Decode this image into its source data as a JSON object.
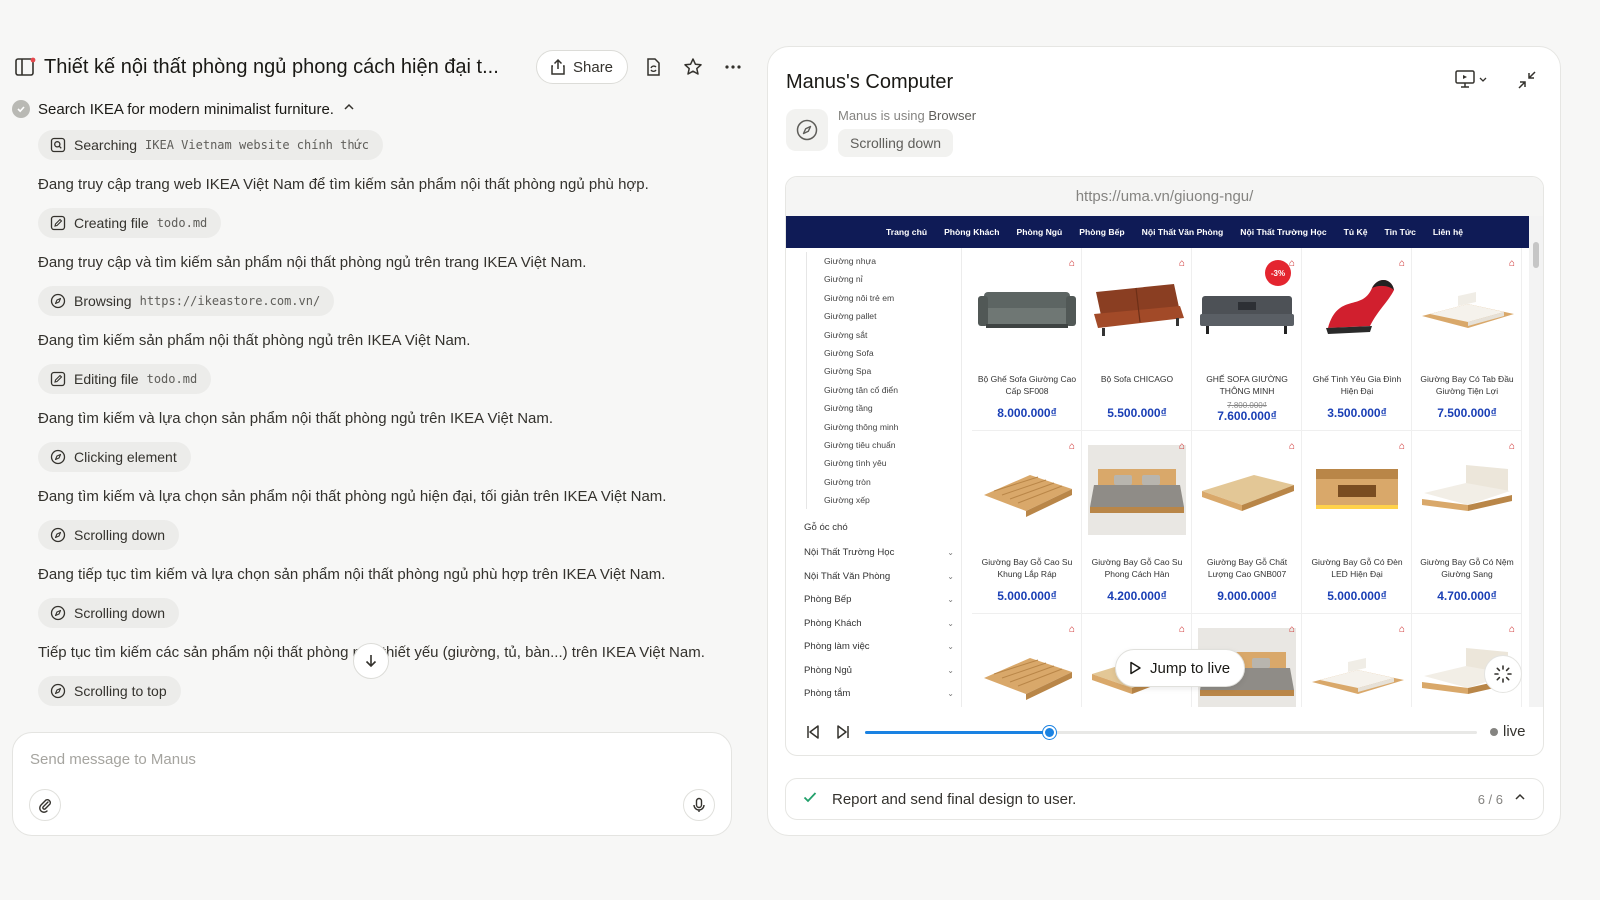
{
  "header": {
    "title": "Thiết kế nội thất phòng ngủ phong cách hiện đại t...",
    "share_label": "Share"
  },
  "task": {
    "title": "Search IKEA for modern minimalist furniture."
  },
  "steps": [
    {
      "chip_label": "Searching",
      "chip_detail": "IKEA Vietnam website chính thức",
      "icon": "search-icon",
      "text": "Đang truy cập trang web IKEA Việt Nam để tìm kiếm sản phẩm nội thất phòng ngủ phù hợp."
    },
    {
      "chip_label": "Creating file",
      "chip_detail": "todo.md",
      "icon": "edit-file-icon",
      "text": "Đang truy cập và tìm kiếm sản phẩm nội thất phòng ngủ trên trang IKEA Việt Nam."
    },
    {
      "chip_label": "Browsing",
      "chip_detail": "https://ikeastore.com.vn/",
      "icon": "compass-icon",
      "text": "Đang tìm kiếm sản phẩm nội thất phòng ngủ trên IKEA Việt Nam."
    },
    {
      "chip_label": "Editing file",
      "chip_detail": "todo.md",
      "icon": "edit-file-icon",
      "text": "Đang tìm kiếm và lựa chọn sản phẩm nội thất phòng ngủ trên IKEA Việt Nam."
    },
    {
      "chip_label": "Clicking element",
      "chip_detail": "",
      "icon": "compass-icon",
      "text": "Đang tìm kiếm và lựa chọn sản phẩm nội thất phòng ngủ hiện đại, tối giản trên IKEA Việt Nam."
    },
    {
      "chip_label": "Scrolling down",
      "chip_detail": "",
      "icon": "compass-icon",
      "text": "Đang tiếp tục tìm kiếm và lựa chọn sản phẩm nội thất phòng ngủ phù hợp trên IKEA Việt Nam."
    },
    {
      "chip_label": "Scrolling down",
      "chip_detail": "",
      "icon": "compass-icon",
      "text": "Tiếp tục tìm kiếm các sản phẩm nội thất phòng ngủ thiết yếu (giường, tủ, bàn...) trên IKEA Việt Nam."
    },
    {
      "chip_label": "Scrolling to top",
      "chip_detail": "",
      "icon": "compass-icon",
      "text": ""
    }
  ],
  "composer": {
    "placeholder": "Send message to Manus"
  },
  "computer": {
    "title": "Manus's Computer",
    "using_prefix": "Manus is using",
    "using_tool": "Browser",
    "action": "Scrolling down",
    "url": "https://uma.vn/giuong-ngu/",
    "jump_label": "Jump to live",
    "live_label": "live",
    "progress": 0.3
  },
  "site": {
    "nav": [
      "Trang chủ",
      "Phòng Khách",
      "Phòng Ngủ",
      "Phòng Bếp",
      "Nội Thất Văn Phòng",
      "Nội Thất Trường Học",
      "Tủ Kệ",
      "Tin Tức",
      "Liên hệ"
    ],
    "subcategories": [
      "Giường nhựa",
      "Giường nỉ",
      "Giường nôi trẻ em",
      "Giường pallet",
      "Giường sắt",
      "Giường Sofa",
      "Giường Spa",
      "Giường tân cổ điển",
      "Giường tầng",
      "Giường thông minh",
      "Giường tiêu chuẩn",
      "Giường tình yêu",
      "Giường tròn",
      "Giường xếp"
    ],
    "plain_category": "Gỗ óc chó",
    "categories": [
      "Nội Thất Trường Học",
      "Nội Thất Văn Phòng",
      "Phòng Bếp",
      "Phòng Khách",
      "Phòng làm việc",
      "Phòng Ngủ",
      "Phòng tắm"
    ],
    "products": [
      {
        "name": "Bộ Ghế Sofa Giường Cao Cấp SF008",
        "price": "8.000.000₫",
        "old": "",
        "badge": "",
        "kind": "sofa-gray"
      },
      {
        "name": "Bộ Sofa CHICAGO",
        "price": "5.500.000₫",
        "old": "",
        "badge": "",
        "kind": "sofa-brown"
      },
      {
        "name": "GHẾ SOFA GIƯỜNG THÔNG MINH",
        "price": "7.600.000₫",
        "old": "7.800.000₫",
        "badge": "-3%",
        "kind": "sofa-dark"
      },
      {
        "name": "Ghế Tình Yêu Gia Đình Hiện Đại",
        "price": "3.500.000₫",
        "old": "",
        "badge": "",
        "kind": "chair-red"
      },
      {
        "name": "Giường Bay Có Tab Đầu Giường Tiện Lợi",
        "price": "7.500.000₫",
        "old": "",
        "badge": "",
        "kind": "bed-white"
      },
      {
        "name": "Giường Bay Gỗ Cao Su Khung Lắp Ráp",
        "price": "5.000.000₫",
        "old": "",
        "badge": "",
        "kind": "bed-frame"
      },
      {
        "name": "Giường Bay Gỗ Cao Su Phong Cách Hàn",
        "price": "4.200.000₫",
        "old": "",
        "badge": "",
        "kind": "bed-gray"
      },
      {
        "name": "Giường Bay Gỗ Chất Lượng Cao GNB007",
        "price": "9.000.000₫",
        "old": "",
        "badge": "",
        "kind": "bed-low"
      },
      {
        "name": "Giường Bay Gỗ Có Đèn LED Hiện Đại",
        "price": "5.000.000₫",
        "old": "",
        "badge": "",
        "kind": "bed-led"
      },
      {
        "name": "Giường Bay Gỗ Có Nệm Giường Sang",
        "price": "4.700.000₫",
        "old": "",
        "badge": "",
        "kind": "bed-cream"
      }
    ]
  },
  "report": {
    "text": "Report and send final design to user.",
    "count": "6 / 6"
  }
}
